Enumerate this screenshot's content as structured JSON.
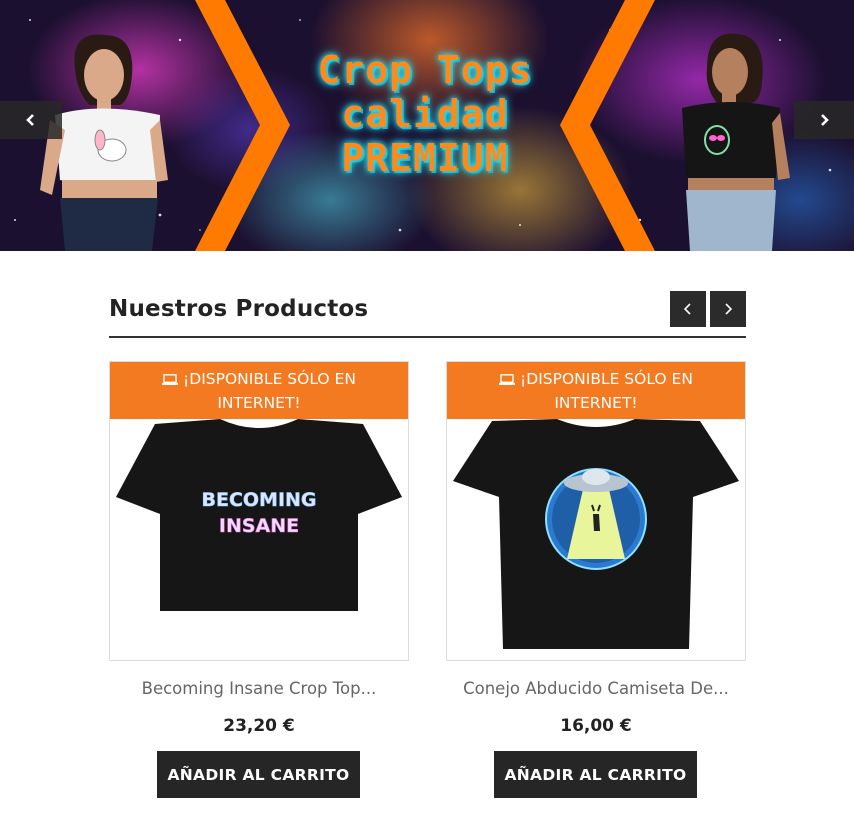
{
  "hero": {
    "title_line1": "Crop Tops",
    "title_line2": "calidad",
    "title_line3": "PREMIUM",
    "prev_icon": "chevron-left-icon",
    "next_icon": "chevron-right-icon",
    "colors": {
      "accent": "#ff7a00",
      "glow": "#22e6ff"
    }
  },
  "products_section": {
    "title": "Nuestros Productos",
    "prev_icon": "chevron-left-icon",
    "next_icon": "chevron-right-icon"
  },
  "products": [
    {
      "badge_icon": "laptop-icon",
      "badge_line1": "¡DISPONIBLE SÓLO EN",
      "badge_line2": "INTERNET!",
      "image_text_line1": "BECOMING",
      "image_text_line2": "INSANE",
      "name": "Becoming Insane Crop Top...",
      "price": "23,20 €",
      "button": "AÑADIR AL CARRITO"
    },
    {
      "badge_icon": "laptop-icon",
      "badge_line1": "¡DISPONIBLE SÓLO EN",
      "badge_line2": "INTERNET!",
      "name": "Conejo Abducido Camiseta De...",
      "price": "16,00 €",
      "button": "AÑADIR AL CARRITO"
    }
  ],
  "colors": {
    "badge": "#f47a21",
    "button": "#262626"
  }
}
